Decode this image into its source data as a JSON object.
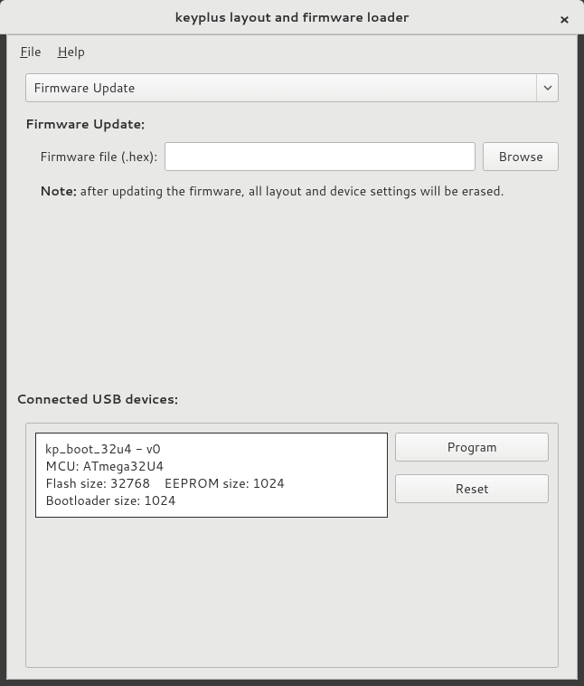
{
  "window": {
    "title": "keyplus layout and firmware loader"
  },
  "menubar": {
    "file": "File",
    "help": "Help"
  },
  "mode_combo": {
    "value": "Firmware Update"
  },
  "firmware_update": {
    "section_label": "Firmware Update:",
    "file_label": "Firmware file (.hex):",
    "file_value": "",
    "browse_label": "Browse",
    "note_bold": "Note:",
    "note_text": " after updating the firmware, all layout and device settings will be erased."
  },
  "devices_section": {
    "label": "Connected USB devices:",
    "program_label": "Program",
    "reset_label": "Reset",
    "device": {
      "line1": "kp_boot_32u4 - v0",
      "line2": "MCU: ATmega32U4",
      "line3": "Flash size: 32768    EEPROM size: 1024",
      "line4": "Bootloader size: 1024"
    }
  }
}
